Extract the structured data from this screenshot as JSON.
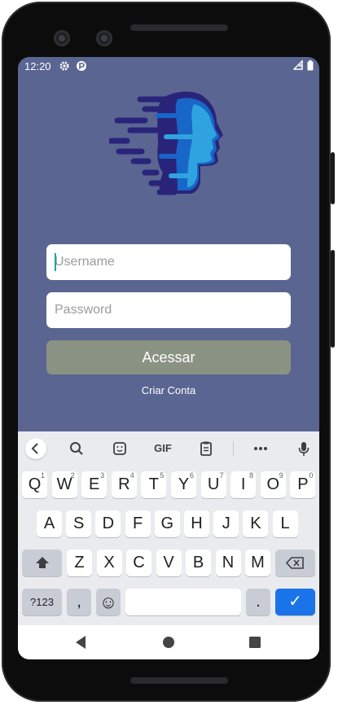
{
  "status_bar": {
    "time": "12:20",
    "icons": [
      "gear-icon",
      "app-notification-icon",
      "signal-icon",
      "battery-icon"
    ]
  },
  "login": {
    "username_placeholder": "Username",
    "password_placeholder": "Password",
    "submit_label": "Acessar",
    "create_account_label": "Criar Conta",
    "colors": {
      "background": "#5a6591",
      "button": "#8a9284",
      "logo_dark": "#29247a",
      "logo_mid": "#1866c7",
      "logo_light": "#2fa3e0"
    }
  },
  "keyboard": {
    "toolbar": [
      "back-chevron-icon",
      "search-icon",
      "sticker-icon",
      "gif-icon",
      "clipboard-icon",
      "more-icon",
      "mic-icon"
    ],
    "gif_label": "GIF",
    "row1": [
      {
        "k": "Q",
        "h": "1"
      },
      {
        "k": "W",
        "h": "2"
      },
      {
        "k": "E",
        "h": "3"
      },
      {
        "k": "R",
        "h": "4"
      },
      {
        "k": "T",
        "h": "5"
      },
      {
        "k": "Y",
        "h": "6"
      },
      {
        "k": "U",
        "h": "7"
      },
      {
        "k": "I",
        "h": "8"
      },
      {
        "k": "O",
        "h": "9"
      },
      {
        "k": "P",
        "h": "0"
      }
    ],
    "row2": [
      "A",
      "S",
      "D",
      "F",
      "G",
      "H",
      "J",
      "K",
      "L"
    ],
    "row3": [
      "Z",
      "X",
      "C",
      "V",
      "B",
      "N",
      "M"
    ],
    "symbols_label": "?123",
    "comma_label": ",",
    "period_label": ".",
    "emoji_label": "☺",
    "enter_label": "✓"
  },
  "navigation": [
    "back-icon",
    "home-icon",
    "recents-icon"
  ]
}
